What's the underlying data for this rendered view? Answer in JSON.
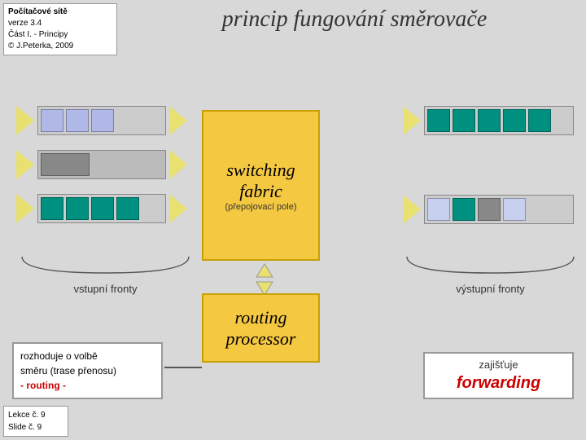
{
  "info_box": {
    "title": "Počítačové sítě",
    "version": "verze 3.4",
    "part": "Část I. - Principy",
    "author": "© J.Peterka, 2009"
  },
  "main_title": "princip fungování směrovače",
  "slide_info": {
    "lecture": "Lekce č. 9",
    "slide": "Slide č. 9"
  },
  "switching_fabric": {
    "label": "switching fabric",
    "subtitle": "(přepojovací pole)"
  },
  "routing_processor": {
    "label": "routing processor"
  },
  "labels": {
    "vstupni_fronty": "vstupní fronty",
    "vystupni_fronty": "výstupní fronty",
    "routing_info_line1": "rozhoduje o volbě",
    "routing_info_line2": "směru (trase přenosu)",
    "routing_highlight": "- routing -",
    "forwarding_info": "zajišťuje",
    "forwarding_highlight": "forwarding"
  },
  "colors": {
    "accent_yellow": "#f5c842",
    "accent_border": "#c8a000",
    "block_lavender": "#b0b8e8",
    "block_teal": "#009080",
    "block_gray": "#888",
    "block_light_lavender": "#c8d0f0",
    "red": "#cc0000",
    "arrow_yellow": "#e8e070"
  }
}
